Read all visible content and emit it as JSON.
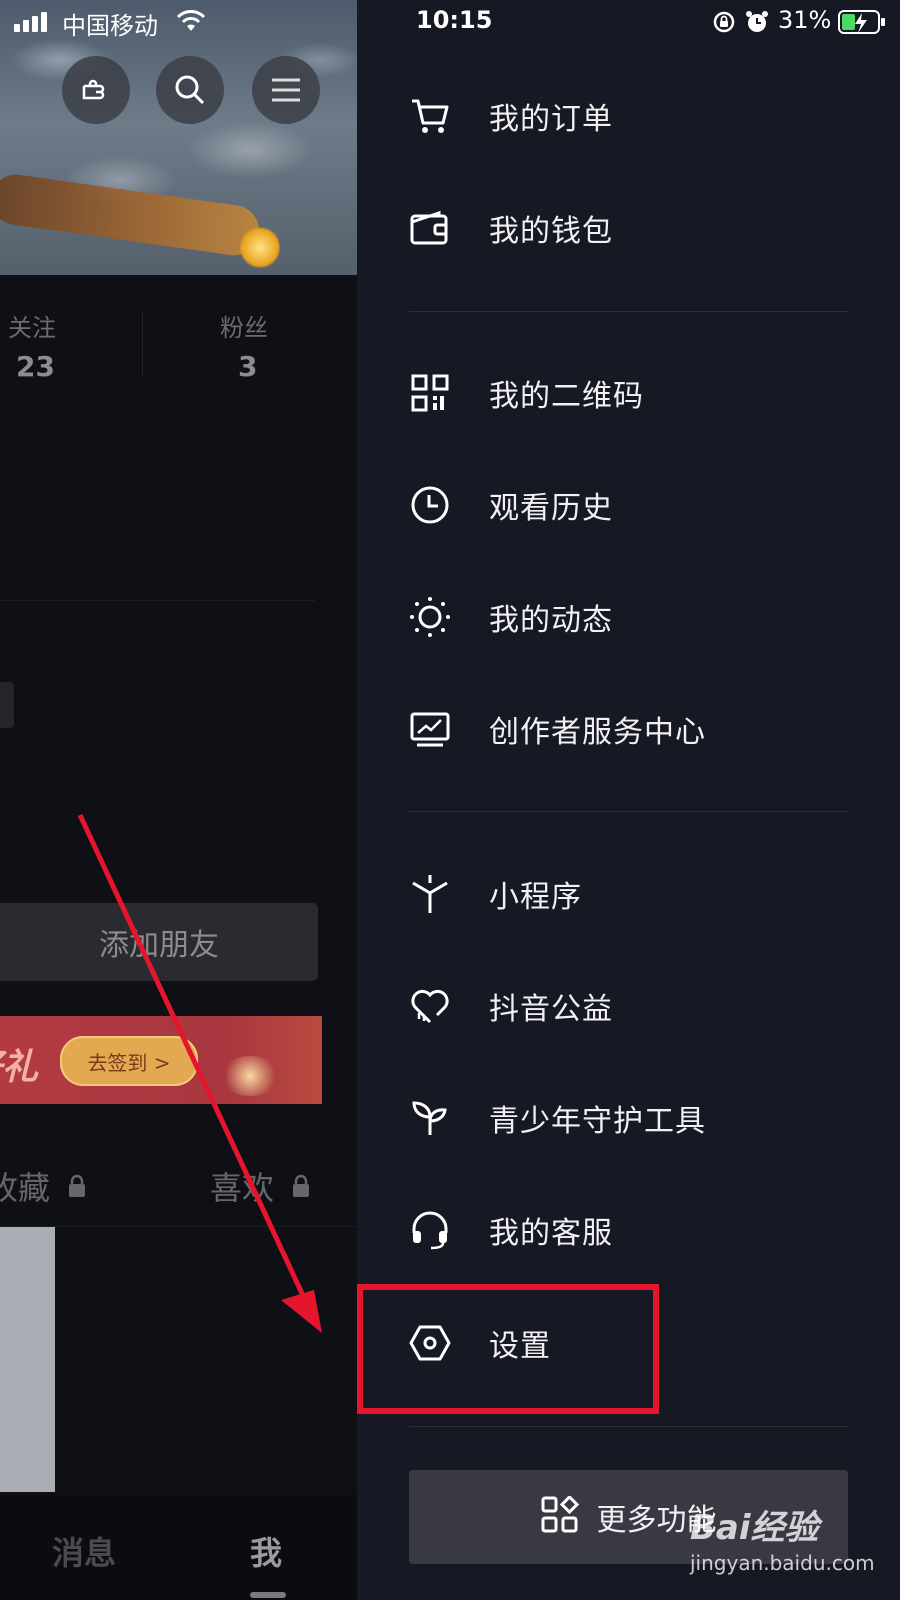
{
  "status_bar": {
    "carrier": "中国移动",
    "time": "10:15",
    "battery": "31%"
  },
  "profile": {
    "stats": [
      {
        "label": "关注",
        "value": "23"
      },
      {
        "label": "粉丝",
        "value": "3"
      }
    ],
    "add_friend_label": "添加朋友",
    "promo_text": "好礼",
    "promo_button": "去签到 >",
    "tabs": [
      "收藏",
      "喜欢"
    ],
    "bottom_nav": [
      "消息",
      "我"
    ]
  },
  "drawer": {
    "menu_items": [
      {
        "label": "我的订单",
        "icon": "cart-icon"
      },
      {
        "label": "我的钱包",
        "icon": "wallet-icon"
      },
      {
        "label": "我的二维码",
        "icon": "qr-code-icon"
      },
      {
        "label": "观看历史",
        "icon": "clock-icon"
      },
      {
        "label": "我的动态",
        "icon": "activity-icon"
      },
      {
        "label": "创作者服务中心",
        "icon": "monitor-chart-icon"
      },
      {
        "label": "小程序",
        "icon": "mini-program-icon"
      },
      {
        "label": "抖音公益",
        "icon": "heart-icon"
      },
      {
        "label": "青少年守护工具",
        "icon": "sprout-icon"
      },
      {
        "label": "我的客服",
        "icon": "headset-icon"
      },
      {
        "label": "设置",
        "icon": "hexagon-settings-icon"
      }
    ],
    "more_button": "更多功能"
  },
  "watermark": {
    "brand": "Bai经验",
    "url": "jingyan.baidu.com"
  },
  "colors": {
    "drawer_bg": "#161823",
    "highlight": "#e5152d",
    "arrow": "#e5152d"
  }
}
